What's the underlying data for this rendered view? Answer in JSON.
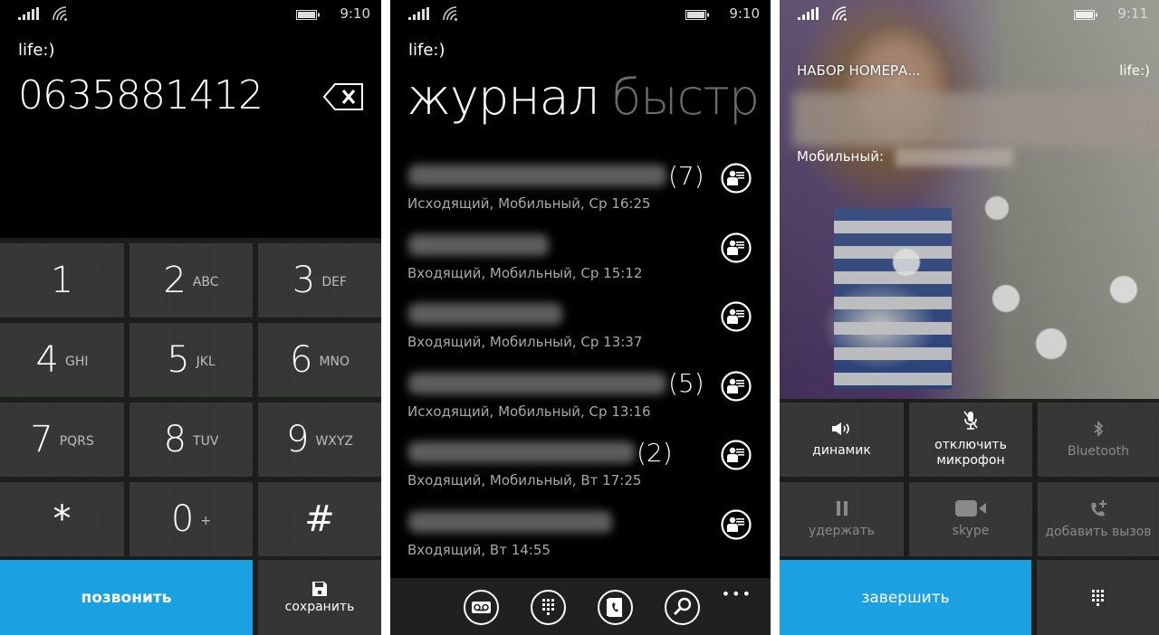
{
  "screens": {
    "dialer": {
      "status": {
        "time": "9:10"
      },
      "carrier": "life:)",
      "number": "0635881412",
      "keys": [
        {
          "digit": "1",
          "letters": ""
        },
        {
          "digit": "2",
          "letters": "ABC"
        },
        {
          "digit": "3",
          "letters": "DEF"
        },
        {
          "digit": "4",
          "letters": "GHI"
        },
        {
          "digit": "5",
          "letters": "JKL"
        },
        {
          "digit": "6",
          "letters": "MNO"
        },
        {
          "digit": "7",
          "letters": "PQRS"
        },
        {
          "digit": "8",
          "letters": "TUV"
        },
        {
          "digit": "9",
          "letters": "WXYZ"
        },
        {
          "digit": "*",
          "letters": ""
        },
        {
          "digit": "0",
          "letters": "+"
        },
        {
          "digit": "#",
          "letters": ""
        }
      ],
      "call_label": "позвонить",
      "save_label": "сохранить"
    },
    "call_log": {
      "status": {
        "time": "9:10"
      },
      "carrier": "life:)",
      "pivot": {
        "active": "журнал",
        "next": "быстр"
      },
      "entries": [
        {
          "name_blurred": true,
          "count": "(7)",
          "detail": "Исходящий, Мобильный, Ср 16:25"
        },
        {
          "name_blurred": true,
          "count": "",
          "detail": "Входящий, Мобильный, Ср 15:12"
        },
        {
          "name_blurred": true,
          "count": "",
          "detail": "Входящий, Мобильный, Ср 13:37"
        },
        {
          "name_blurred": true,
          "count": "(5)",
          "detail": "Исходящий, Мобильный, Ср 13:16"
        },
        {
          "name_blurred": true,
          "count": "(2)",
          "detail": "Входящий, Мобильный, Вт 17:25"
        },
        {
          "name_blurred": true,
          "count": "",
          "detail": "Входящий, Вт 14:55"
        }
      ],
      "appbar": {
        "icons": [
          "voicemail-icon",
          "keypad-icon",
          "contacts-icon",
          "search-icon"
        ],
        "more": "•••"
      }
    },
    "in_call": {
      "status": {
        "time": "9:11"
      },
      "state": "НАБОР НОМЕРА...",
      "carrier": "life:)",
      "phone_type": "Мобильный:",
      "controls": [
        {
          "label": "динамик",
          "icon": "speaker-icon",
          "enabled": true
        },
        {
          "label": "отключить микрофон",
          "icon": "mute-mic-icon",
          "enabled": true
        },
        {
          "label": "Bluetooth",
          "icon": "bluetooth-icon",
          "enabled": false
        },
        {
          "label": "удержать",
          "icon": "pause-icon",
          "enabled": false
        },
        {
          "label": "skype",
          "icon": "video-icon",
          "enabled": false
        },
        {
          "label": "добавить вызов",
          "icon": "add-call-icon",
          "enabled": false
        }
      ],
      "end_label": "завершить",
      "colors": {
        "accent": "#1ba1e2",
        "tile": "#353535"
      }
    }
  }
}
